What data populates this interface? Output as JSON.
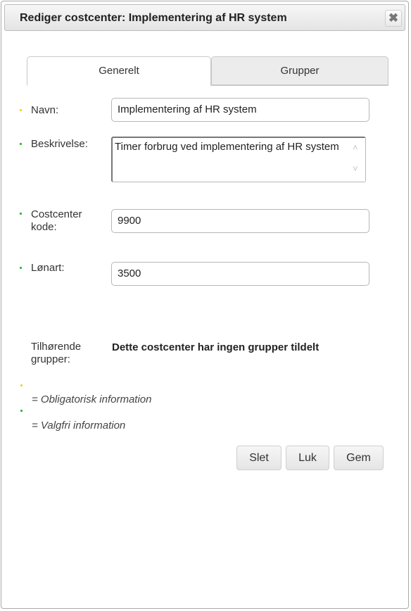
{
  "dialog": {
    "title": "Rediger costcenter: Implementering af HR system",
    "close_glyph": "✖"
  },
  "tabs": [
    {
      "label": "Generelt",
      "active": true
    },
    {
      "label": "Grupper",
      "active": false
    }
  ],
  "form": {
    "name": {
      "label": "Navn:",
      "value": "Implementering af HR system",
      "required": true
    },
    "description": {
      "label": "Beskrivelse:",
      "value": "Timer forbrug ved implementering af HR system",
      "required": false
    },
    "costcenter_code": {
      "label": "Costcenter kode:",
      "value": "9900",
      "required": false
    },
    "wage_type": {
      "label": "Lønart:",
      "value": "3500",
      "required": false
    },
    "groups": {
      "label": "Tilhørende grupper:",
      "value": "Dette costcenter har ingen grupper tildelt"
    }
  },
  "legend": {
    "required": "=  Obligatorisk information",
    "optional": "=  Valgfri information"
  },
  "colors": {
    "required_dot": "#f0d020",
    "optional_dot": "#2cb52c"
  },
  "buttons": {
    "delete": "Slet",
    "close": "Luk",
    "save": "Gem"
  },
  "icons": {
    "close": "close-icon",
    "scroll_up": "chevron-up-icon",
    "scroll_down": "chevron-down-icon"
  }
}
